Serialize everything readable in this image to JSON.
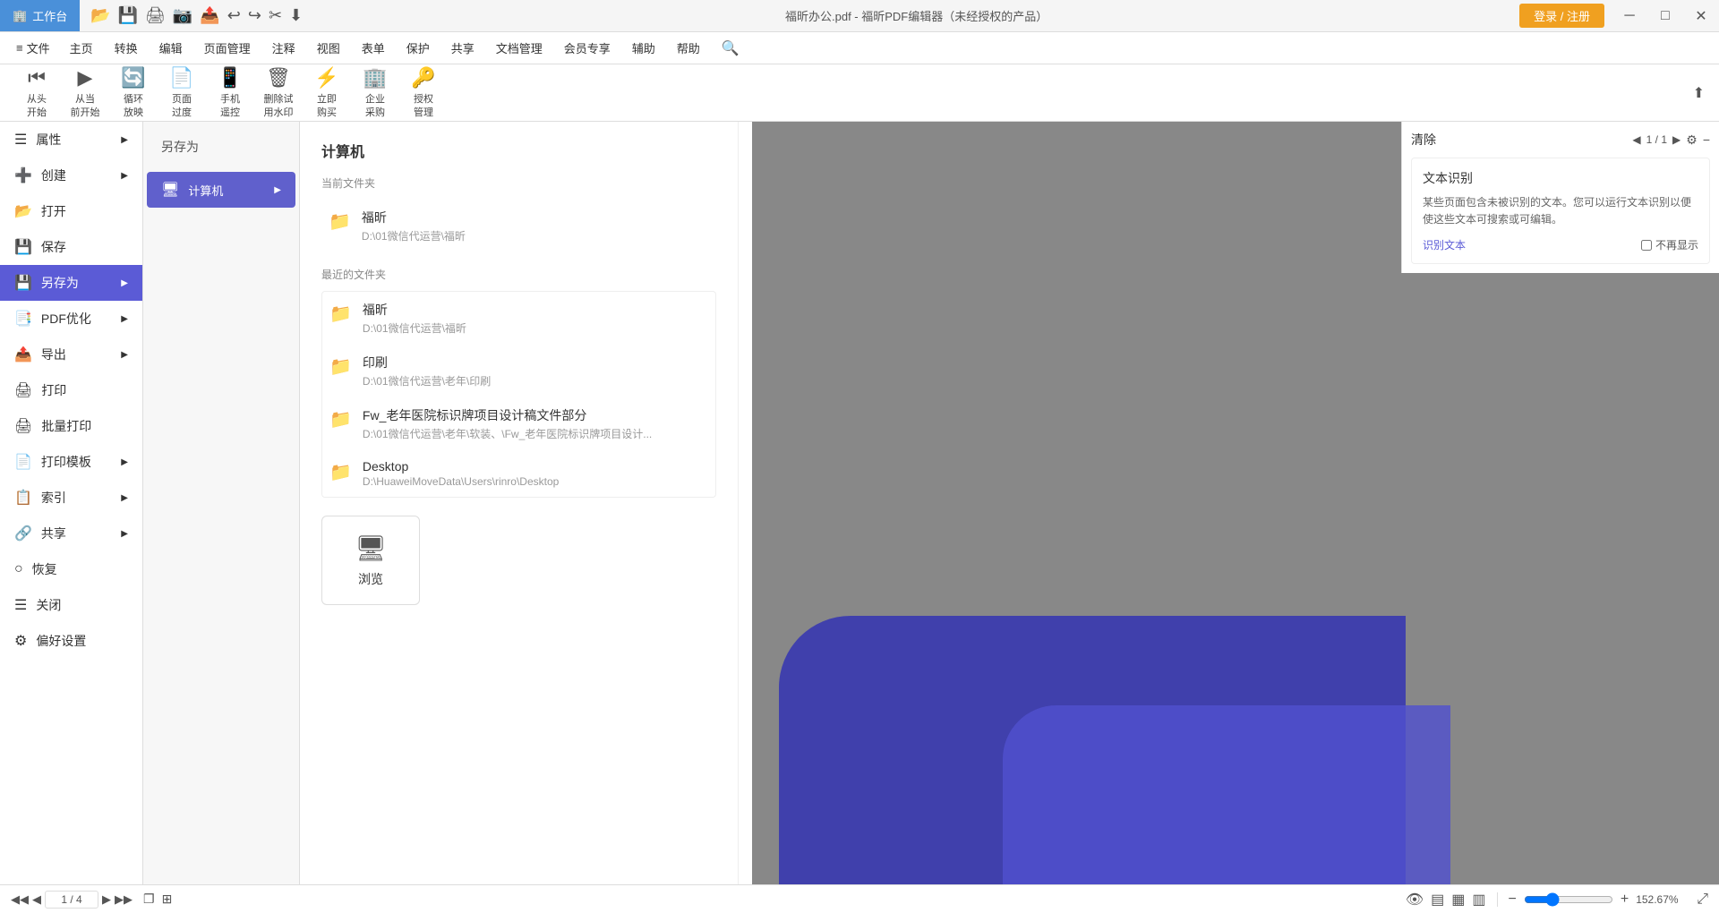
{
  "titlebar": {
    "workbench_label": "工作台",
    "title": "福昕办公.pdf - 福昕PDF编辑器（未经授权的产品）",
    "login_label": "登录 / 注册",
    "min_icon": "─",
    "max_icon": "□",
    "close_icon": "✕"
  },
  "menubar": {
    "menu_icon": "≡",
    "file_label": "文件",
    "items": [
      {
        "label": "主页"
      },
      {
        "label": "转换"
      },
      {
        "label": "编辑"
      },
      {
        "label": "页面管理"
      },
      {
        "label": "注释"
      },
      {
        "label": "视图"
      },
      {
        "label": "表单"
      },
      {
        "label": "保护"
      },
      {
        "label": "共享"
      },
      {
        "label": "文档管理"
      },
      {
        "label": "会员专享"
      },
      {
        "label": "辅助"
      },
      {
        "label": "帮助"
      },
      {
        "label": "🔍"
      }
    ]
  },
  "toolbar": {
    "items": [
      {
        "icon": "⏮",
        "label": "从头\n开始"
      },
      {
        "icon": "▶",
        "label": "从当\n前开始"
      },
      {
        "icon": "🔄",
        "label": "循环\n放映"
      },
      {
        "icon": "📄",
        "label": "页面\n过度"
      },
      {
        "icon": "📱",
        "label": "手机\n遥控"
      },
      {
        "icon": "🗑",
        "label": "删除试\n用水印"
      },
      {
        "icon": "⚡",
        "label": "立即\n购买"
      },
      {
        "icon": "🏢",
        "label": "企业\n采购"
      },
      {
        "icon": "🔑",
        "label": "授权\n管理"
      }
    ]
  },
  "left_menu": {
    "items": [
      {
        "icon": "≡",
        "label": "属性",
        "has_arrow": true
      },
      {
        "icon": "+",
        "label": "创建",
        "has_arrow": true
      },
      {
        "icon": "📂",
        "label": "打开",
        "has_arrow": false
      },
      {
        "icon": "💾",
        "label": "保存",
        "has_arrow": false
      },
      {
        "icon": "💾",
        "label": "另存为",
        "has_arrow": true,
        "active": true
      },
      {
        "icon": "📑",
        "label": "PDF优化",
        "has_arrow": true
      },
      {
        "icon": "📤",
        "label": "导出",
        "has_arrow": true
      },
      {
        "icon": "🖨",
        "label": "打印",
        "has_arrow": false
      },
      {
        "icon": "🖨",
        "label": "批量打印",
        "has_arrow": false
      },
      {
        "icon": "📄",
        "label": "打印模板",
        "has_arrow": true
      },
      {
        "icon": "📋",
        "label": "索引",
        "has_arrow": true
      },
      {
        "icon": "🔗",
        "label": "共享",
        "has_arrow": true
      },
      {
        "icon": "↩",
        "label": "恢复",
        "has_arrow": false
      },
      {
        "icon": "✕",
        "label": "关闭",
        "has_arrow": false
      },
      {
        "icon": "⚙",
        "label": "偏好设置",
        "has_arrow": false
      }
    ]
  },
  "saveas_panel": {
    "items": [
      {
        "icon": "💾",
        "label": "另存为",
        "has_arrow": false
      },
      {
        "icon": "🖥",
        "label": "计算机",
        "has_arrow": true,
        "active": true
      }
    ]
  },
  "computer_panel": {
    "title": "计算机",
    "current_folder_label": "当前文件夹",
    "current_folder": {
      "name": "福昕",
      "path": "D:\\01微信代运营\\福昕"
    },
    "recent_label": "最近的文件夹",
    "recent_folders": [
      {
        "name": "福昕",
        "path": "D:\\01微信代运营\\福昕"
      },
      {
        "name": "印刷",
        "path": "D:\\01微信代运营\\老年\\印刷"
      },
      {
        "name": "Fw_老年医院标识牌项目设计稿文件部分",
        "path": "D:\\01微信代运营\\老年\\软装、\\Fw_老年医院标识牌项目设计..."
      },
      {
        "name": "Desktop",
        "path": "D:\\HuaweiMoveData\\Users\\rinro\\Desktop"
      }
    ],
    "browse_label": "浏览"
  },
  "right_panel": {
    "clear_label": "清除",
    "page_indicator": "1 / 1",
    "ocr_title": "文本识别",
    "ocr_desc": "某些页面包含未被识别的文本。您可以运行文本识别以便使这些文本可搜索或可编辑。",
    "ocr_link": "识别文本",
    "no_show_label": "不再显示"
  },
  "statusbar": {
    "prev_page_icon": "◀",
    "first_page_icon": "◀◀",
    "next_page_icon": "▶",
    "last_page_icon": "▶▶",
    "current_page": "1 / 4",
    "copy_icon": "❐",
    "fit_icon": "⊞",
    "view_icons": [
      "👁",
      "▤",
      "▦",
      "▥"
    ],
    "zoom_minus": "−",
    "zoom_plus": "+",
    "zoom_level": "152.67%",
    "fullscreen_icon": "⤢"
  },
  "colors": {
    "accent": "#5b5bd6",
    "active_menu": "#5b5bd6",
    "active_saveas": "#6060cc",
    "login_btn": "#f0a020",
    "titlebar_workbench": "#4a90d9",
    "ocr_link": "#5b5bd6"
  }
}
